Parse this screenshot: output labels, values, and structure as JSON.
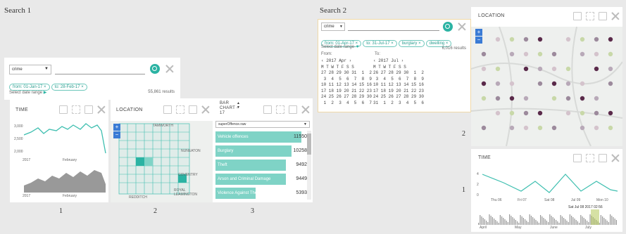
{
  "search1": {
    "title": "Search 1",
    "select_value": "crime",
    "chips": [
      "from: 01-Jan-17 ×",
      "to: 28-Feb-17 ×"
    ],
    "date_label": "Select date range",
    "results": "55,861 results",
    "time_panel": {
      "title": "TIME",
      "y_ticks": [
        "3,000",
        "2,500",
        "2,000"
      ],
      "x_label_top": "2017",
      "x_label_top2": "February",
      "x_label_bot": "2017",
      "x_label_bot2": "February"
    },
    "location_panel": {
      "title": "LOCATION",
      "places": [
        "TAMWORTH",
        "NUNEATON",
        "COVENTRY",
        "ROYAL LEAMINGTON",
        "REDDITCH"
      ]
    },
    "bar_panel": {
      "title": "BAR CHART - 17",
      "select_value": "superOffence.raw",
      "chart_data": {
        "type": "bar",
        "categories": [
          "Vehicle offences",
          "Burglary",
          "Theft",
          "Arson and Criminal Damage",
          "Violence Against The Person"
        ],
        "values": [
          11550,
          10258,
          9492,
          9449,
          5393
        ]
      },
      "display_values": [
        "11550",
        "10258",
        "9492",
        "9449",
        "5393"
      ]
    },
    "captions": [
      "1",
      "2",
      "3"
    ]
  },
  "search2": {
    "title": "Search 2",
    "select_value": "crime",
    "chips": [
      "from: 01-Apr-17 ×",
      "to: 31-Jul-17 ×",
      "burglary ×",
      "dwelling ×"
    ],
    "date_label": "Select date range",
    "results": "6,016 results",
    "from_label": "From:",
    "to_label": "To:",
    "cal_from_header": "2017 Apr",
    "cal_to_header": "2017 Jul",
    "cal_days": "M T W T F S S",
    "cal_from_rows": [
      "27 28 29 30 31  1  2",
      " 3  4  5  6  7  8  9",
      "10 11 12 13 14 15 16",
      "17 18 19 20 21 22 23",
      "24 25 26 27 28 29 30",
      " 1  2  3  4  5  6  7"
    ],
    "cal_to_rows": [
      "26 27 28 29 30  1  2",
      " 3  4  5  6  7  8  9",
      "10 11 12 13 14 15 16",
      "17 18 19 20 21 22 23",
      "24 25 26 27 28 29 30",
      "31  1  2  3  4  5  6"
    ],
    "location_panel": {
      "title": "LOCATION"
    },
    "time_panel": {
      "title": "TIME",
      "y_ticks": [
        "4",
        "2",
        "0"
      ],
      "x_ticks": [
        "Thu 06",
        "Fri 07",
        "Sat 08",
        "Jul 09",
        "Mon 10"
      ],
      "tooltip": "Sat Jul 08 2017 02:56",
      "month_ticks": [
        "April",
        "May",
        "June",
        "July"
      ]
    },
    "captions": [
      "2",
      "1"
    ]
  },
  "colors": {
    "accent": "#2bb3a3",
    "bar": "#7fd3c6",
    "line": "#3fbfb0"
  }
}
